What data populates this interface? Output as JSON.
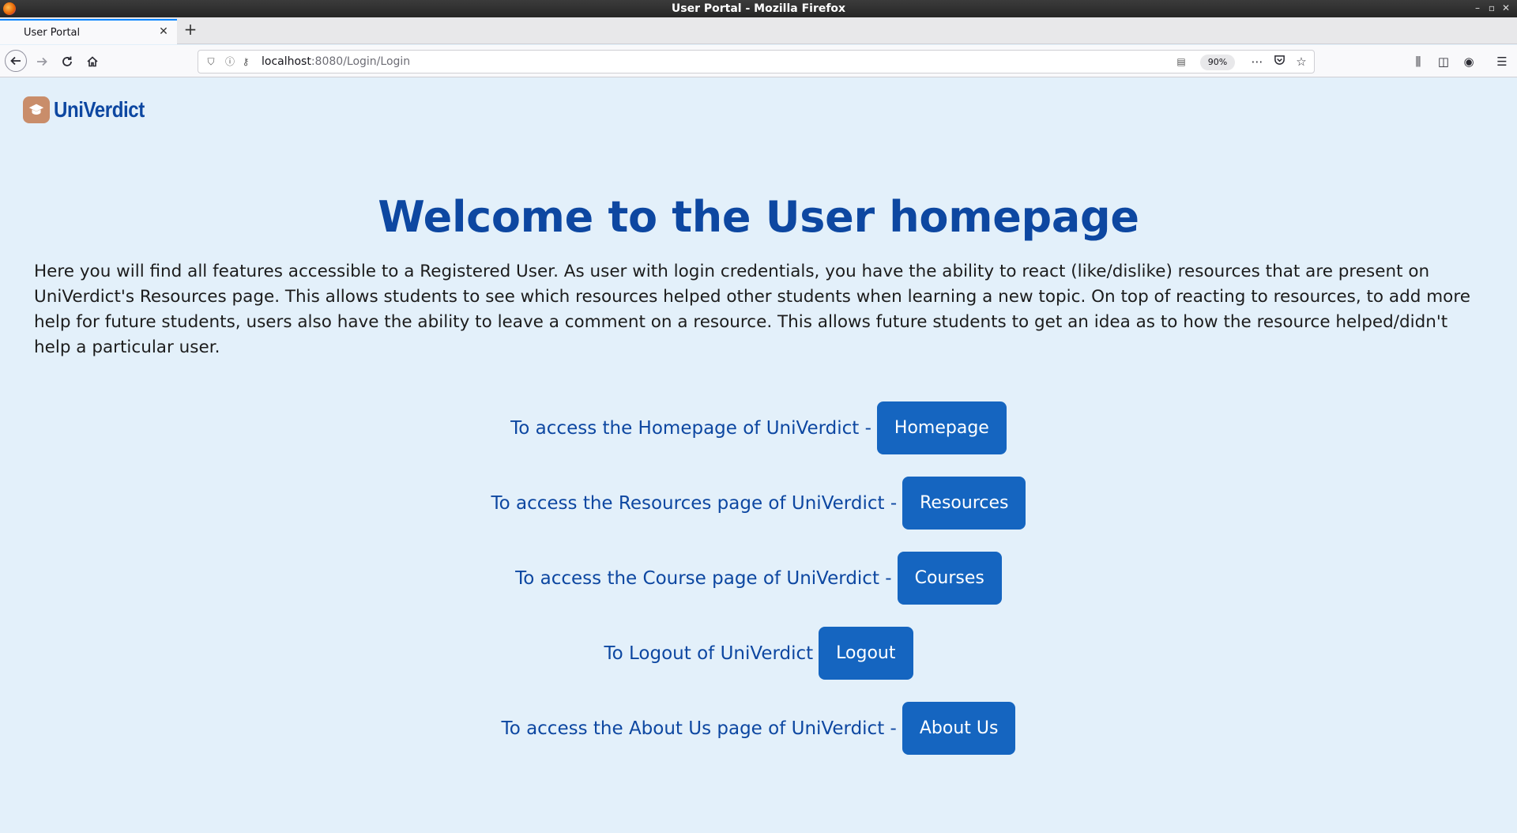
{
  "window": {
    "title": "User Portal - Mozilla Firefox"
  },
  "browser": {
    "tab_title": "User Portal",
    "url_host": "localhost",
    "url_path": ":8080/Login/Login",
    "zoom": "90%"
  },
  "brand": {
    "name": "UniVerdict"
  },
  "main": {
    "headline": "Welcome to the User homepage",
    "intro": "Here you will find all features accessible to a Registered User. As user with login credentials, you have the ability to react (like/dislike) resources that are present on UniVerdict's Resources page. This allows students to see which resources helped other students when learning a new topic. On top of reacting to resources, to add more help for future students, users also have the ability to leave a comment on a resource. This allows future students to get an idea as to how the resource helped/didn't help a particular user.",
    "links": [
      {
        "label": "To access the Homepage of UniVerdict -",
        "button": "Homepage"
      },
      {
        "label": "To access the Resources page of UniVerdict -",
        "button": "Resources"
      },
      {
        "label": "To access the Course page of UniVerdict -",
        "button": "Courses"
      },
      {
        "label": "To Logout of UniVerdict",
        "button": "Logout"
      },
      {
        "label": "To access the About Us page of UniVerdict -",
        "button": "About Us"
      }
    ]
  },
  "colors": {
    "page_bg": "#e3f0fa",
    "brand_blue": "#0d47a1",
    "button_blue": "#1565c0",
    "logo_bg": "#c98d6a"
  }
}
